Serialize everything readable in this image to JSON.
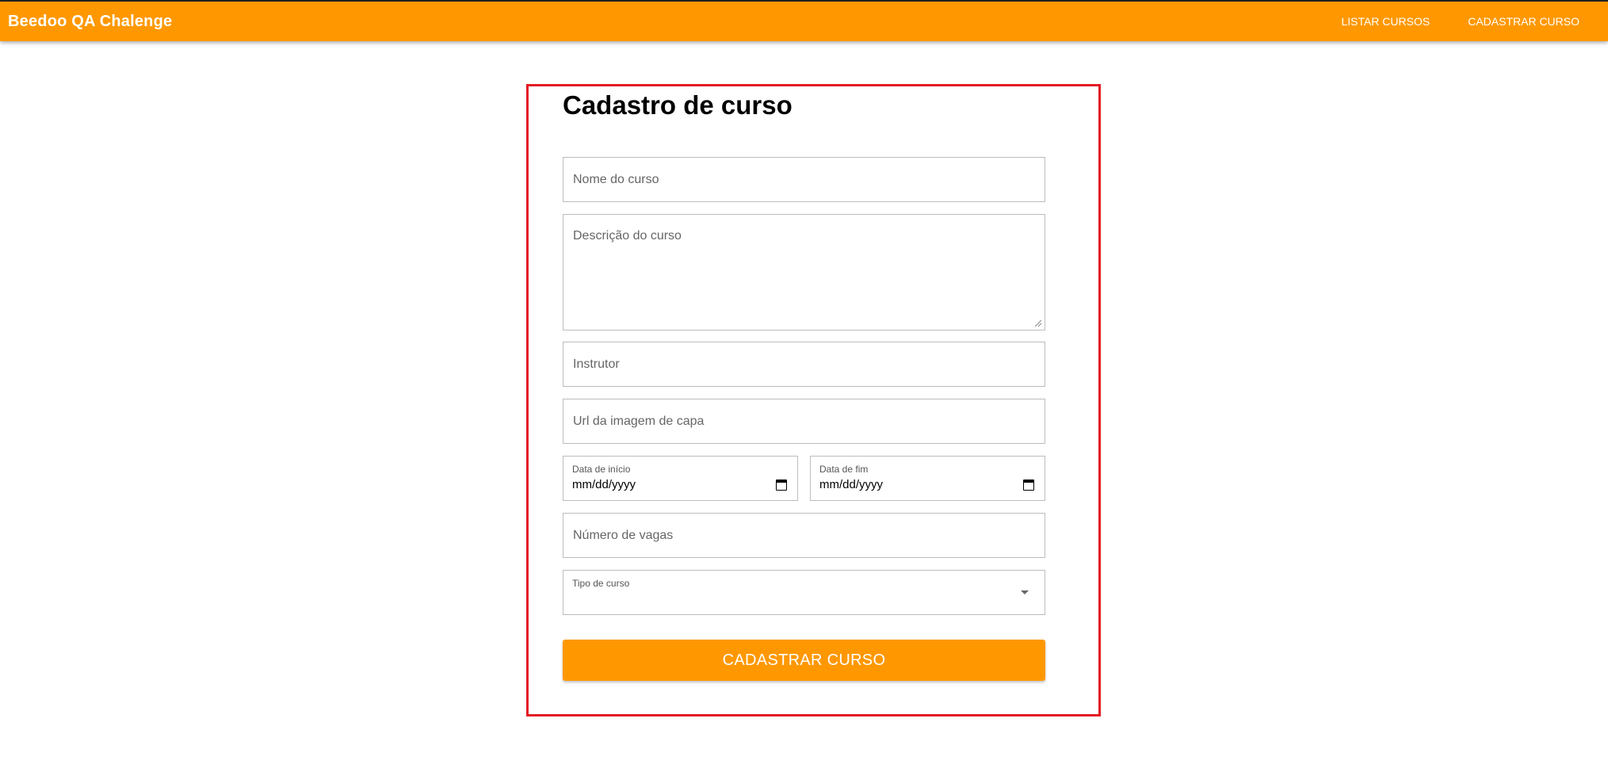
{
  "app": {
    "title": "Beedoo QA Chalenge",
    "accent_color": "#ff9800",
    "highlight_color": "#e31b23"
  },
  "nav": {
    "items": [
      {
        "label": "LISTAR CURSOS"
      },
      {
        "label": "CADASTRAR CURSO"
      }
    ]
  },
  "form": {
    "title": "Cadastro de curso",
    "name_placeholder": "Nome do curso",
    "description_placeholder": "Descrição do curso",
    "instructor_placeholder": "Instrutor",
    "cover_url_placeholder": "Url da imagem de capa",
    "start_date": {
      "label": "Data de início",
      "value": "mm/dd/yyyy"
    },
    "end_date": {
      "label": "Data de fim",
      "value": "mm/dd/yyyy"
    },
    "seats_placeholder": "Número de vagas",
    "course_type": {
      "label": "Tipo de curso",
      "value": ""
    },
    "submit_label": "CADASTRAR CURSO"
  },
  "icons": {
    "calendar": "calendar-icon",
    "dropdown": "chevron-down-icon"
  }
}
